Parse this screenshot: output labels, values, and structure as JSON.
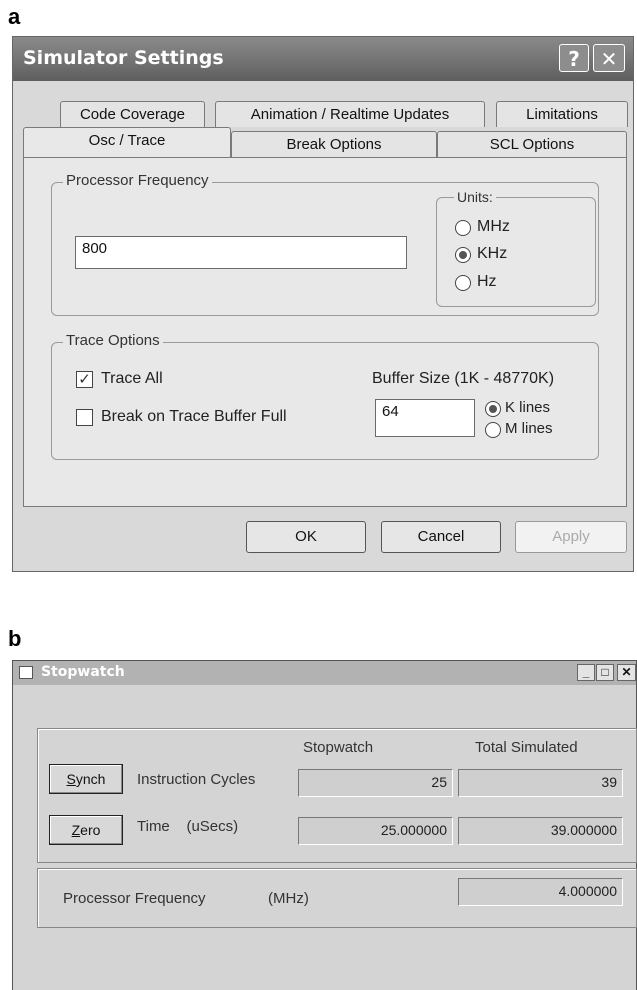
{
  "panel_a": {
    "letter": "a",
    "window": {
      "title": "Simulator Settings",
      "help_symbol": "?",
      "close_symbol": "✕"
    },
    "tabs_row1": [
      "Code Coverage",
      "Animation / Realtime Updates",
      "Limitations"
    ],
    "tabs_row2": [
      "Osc / Trace",
      "Break Options",
      "SCL Options"
    ],
    "active_tab": "Osc / Trace",
    "processor_frequency": {
      "legend": "Processor Frequency",
      "value": "800",
      "units_legend": "Units:",
      "units": [
        {
          "label": "MHz",
          "selected": false
        },
        {
          "label": "KHz",
          "selected": true
        },
        {
          "label": "Hz",
          "selected": false
        }
      ]
    },
    "trace_options": {
      "legend": "Trace Options",
      "trace_all_label": "Trace All",
      "trace_all_checked": true,
      "break_full_label": "Break on Trace Buffer Full",
      "break_full_checked": false,
      "buffer_size_label": "Buffer Size (1K - 48770K)",
      "buffer_value": "64",
      "buffer_units": [
        {
          "label": "K lines",
          "selected": true
        },
        {
          "label": "M lines",
          "selected": false
        }
      ]
    },
    "buttons": {
      "ok": "OK",
      "cancel": "Cancel",
      "apply": "Apply"
    }
  },
  "panel_b": {
    "letter": "b",
    "window": {
      "title": "Stopwatch",
      "minimize_symbol": "_",
      "maximize_symbol": "□",
      "close_symbol": "✕"
    },
    "headers": {
      "stopwatch": "Stopwatch",
      "total": "Total Simulated"
    },
    "rows": [
      {
        "button": "Synch",
        "button_hotkey": "S",
        "button_rest": "ynch",
        "label": "Instruction Cycles",
        "stopwatch": "25",
        "total": "39"
      },
      {
        "button": "Zero",
        "button_hotkey": "Z",
        "button_rest": "ero",
        "label": "Time    (uSecs)",
        "stopwatch": "25.000000",
        "total": "39.000000"
      }
    ],
    "processor_frequency": {
      "label": "Processor Frequency",
      "units": "(MHz)",
      "value": "4.000000"
    }
  }
}
